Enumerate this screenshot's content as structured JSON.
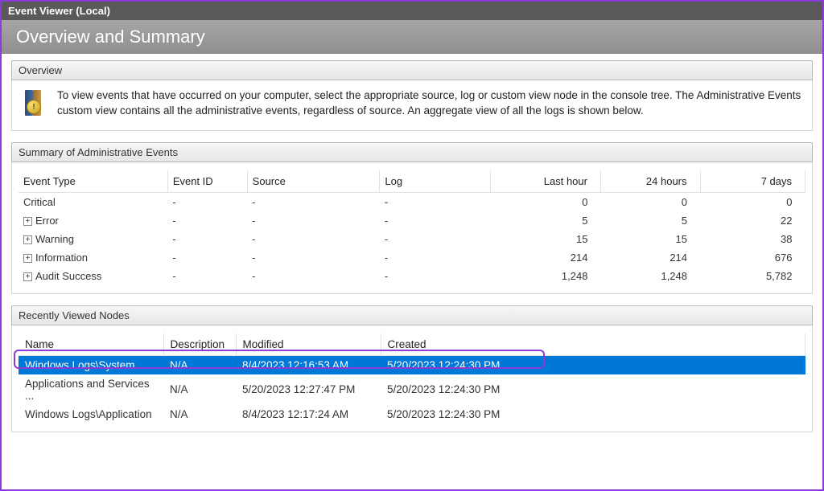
{
  "titlebar": "Event Viewer (Local)",
  "header": "Overview and Summary",
  "overview": {
    "title": "Overview",
    "text": "To view events that have occurred on your computer, select the appropriate source, log or custom view node in the console tree. The Administrative Events custom view contains all the administrative events, regardless of source. An aggregate view of all the logs is shown below."
  },
  "summary": {
    "title": "Summary of Administrative Events",
    "columns": [
      "Event Type",
      "Event ID",
      "Source",
      "Log",
      "Last hour",
      "24 hours",
      "7 days"
    ],
    "rows": [
      {
        "type": "Critical",
        "expandable": false,
        "event_id": "-",
        "source": "-",
        "log": "-",
        "last_hour": "0",
        "h24": "0",
        "d7": "0"
      },
      {
        "type": "Error",
        "expandable": true,
        "event_id": "-",
        "source": "-",
        "log": "-",
        "last_hour": "5",
        "h24": "5",
        "d7": "22"
      },
      {
        "type": "Warning",
        "expandable": true,
        "event_id": "-",
        "source": "-",
        "log": "-",
        "last_hour": "15",
        "h24": "15",
        "d7": "38"
      },
      {
        "type": "Information",
        "expandable": true,
        "event_id": "-",
        "source": "-",
        "log": "-",
        "last_hour": "214",
        "h24": "214",
        "d7": "676"
      },
      {
        "type": "Audit Success",
        "expandable": true,
        "event_id": "-",
        "source": "-",
        "log": "-",
        "last_hour": "1,248",
        "h24": "1,248",
        "d7": "5,782"
      }
    ]
  },
  "recent": {
    "title": "Recently Viewed Nodes",
    "columns": [
      "Name",
      "Description",
      "Modified",
      "Created"
    ],
    "rows": [
      {
        "name": "Windows Logs\\System",
        "description": "N/A",
        "modified": "8/4/2023 12:16:53 AM",
        "created": "5/20/2023 12:24:30 PM",
        "selected": true
      },
      {
        "name": "Applications and Services ...",
        "description": "N/A",
        "modified": "5/20/2023 12:27:47 PM",
        "created": "5/20/2023 12:24:30 PM",
        "selected": false
      },
      {
        "name": "Windows Logs\\Application",
        "description": "N/A",
        "modified": "8/4/2023 12:17:24 AM",
        "created": "5/20/2023 12:24:30 PM",
        "selected": false
      }
    ]
  }
}
